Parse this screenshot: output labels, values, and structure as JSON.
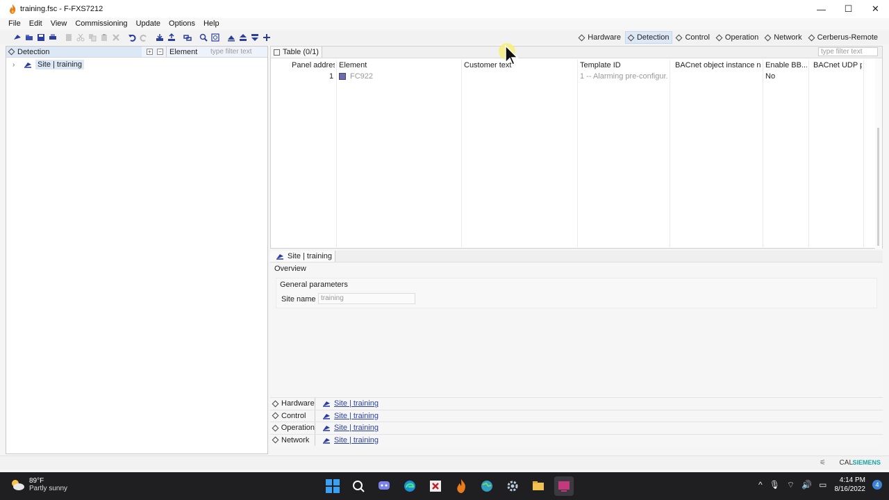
{
  "window": {
    "title": "training.fsc - F-FXS7212",
    "minimize": "—",
    "maximize": "☐",
    "close": "✕"
  },
  "menu": [
    "File",
    "Edit",
    "View",
    "Commissioning",
    "Update",
    "Options",
    "Help"
  ],
  "views": [
    {
      "label": "Hardware",
      "active": false
    },
    {
      "label": "Detection",
      "active": true
    },
    {
      "label": "Control",
      "active": false
    },
    {
      "label": "Operation",
      "active": false
    },
    {
      "label": "Network",
      "active": false
    },
    {
      "label": "Cerberus-Remote",
      "active": false
    }
  ],
  "left_panel": {
    "title": "Detection",
    "column": "Element",
    "filter_placeholder": "type filter text",
    "tree": [
      {
        "label": "Site | training",
        "expander": "›"
      }
    ]
  },
  "table_panel": {
    "tab": "Table (0/1)",
    "filter_placeholder": "type filter text",
    "columns": [
      "Panel address",
      "Element",
      "Customer text",
      "Template ID",
      "BACnet object instance nu...",
      "Enable BB...",
      "BACnet UDP p..."
    ],
    "rows": [
      {
        "panel_address": "1",
        "element": "FC922",
        "customer_text": "",
        "template_id": "1 -- Alarming pre-configur...",
        "bacnet_instance": "",
        "enable_bb": "No",
        "bacnet_udp": ""
      }
    ]
  },
  "detail_panel": {
    "tab": "Site | training",
    "overview": "Overview",
    "group_title": "General parameters",
    "site_name_label": "Site name",
    "site_name_value": "training"
  },
  "view_rows": [
    {
      "name": "Hardware",
      "link": "Site | training"
    },
    {
      "name": "Control",
      "link": "Site | training"
    },
    {
      "name": "Operation",
      "link": "Site | training"
    },
    {
      "name": "Network",
      "link": "Site | training"
    }
  ],
  "statusbar": {
    "cal": "CAL",
    "brand": "SIEMENS"
  },
  "taskbar": {
    "temp": "89°F",
    "condition": "Partly sunny",
    "time": "4:14 PM",
    "date": "8/16/2022",
    "notifications": "4"
  },
  "colors": {
    "accent_selection": "#dde8f6",
    "link": "#2a3fa8",
    "brand": "#1aa3a3",
    "taskbar": "#1f1f22"
  }
}
